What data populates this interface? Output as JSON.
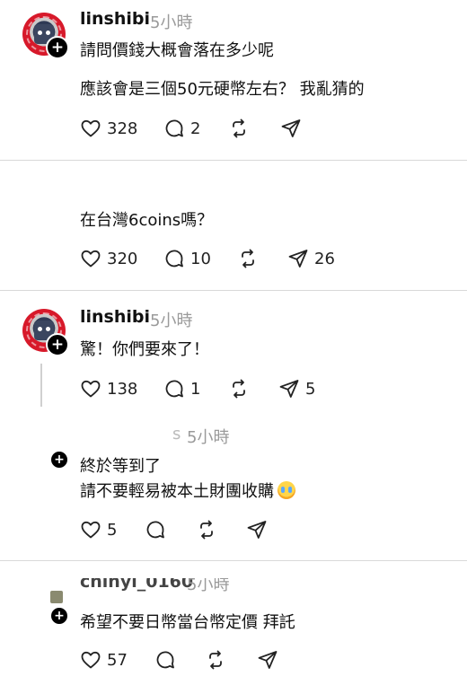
{
  "posts": [
    {
      "username": "linshibi",
      "time": "5小時",
      "lines": [
        "請問價錢大概會落在多少呢",
        "應該會是三個50元硬幣左右？ 我亂猜的"
      ],
      "likes": "328",
      "comments": "2",
      "shares": ""
    },
    {
      "lines": [
        "在台灣6coins嗎？"
      ],
      "likes": "320",
      "comments": "10",
      "shares": "26"
    },
    {
      "username": "linshibi",
      "time": "5小時",
      "lines": [
        "驚！你們要來了！"
      ],
      "likes": "138",
      "comments": "1",
      "shares": "5"
    },
    {
      "username_partial": "s",
      "time": "5小時",
      "lines": [
        "終於等到了",
        "請不要輕易被本土財團收購"
      ],
      "emoji": "crying-face",
      "likes": "5"
    },
    {
      "username_partial": "chinyi_0160",
      "time": "5小時",
      "lines": [
        "希望不要日幣當台幣定價 拜託"
      ],
      "likes": "57"
    }
  ]
}
